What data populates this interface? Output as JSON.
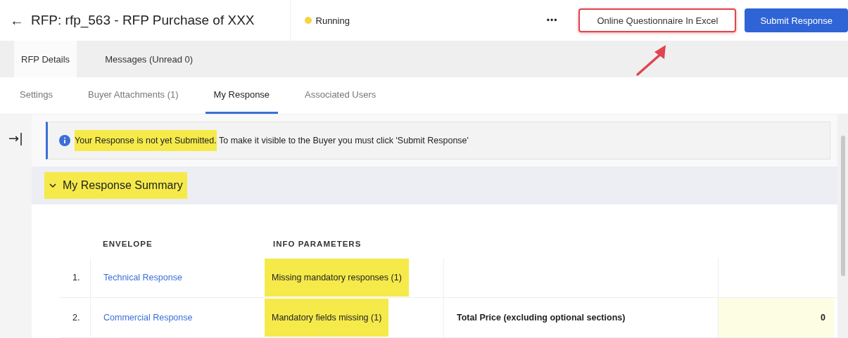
{
  "header": {
    "back": "←",
    "title": "RFP: rfp_563 - RFP Purchase of XXX",
    "status": {
      "label": "Running",
      "color": "#f5d442"
    },
    "more": "•••",
    "buttons": [
      {
        "label": "Online Questionnaire In Excel",
        "kind": "secondary",
        "annotated": true
      },
      {
        "label": "Submit Response",
        "kind": "primary",
        "annotated": false
      }
    ]
  },
  "tabs": [
    {
      "label": "RFP Details",
      "selected": true
    },
    {
      "label": "Messages (Unread 0)",
      "selected": false
    }
  ],
  "subtabs": [
    {
      "label": "Settings",
      "selected": false
    },
    {
      "label": "Buyer Attachments (1)",
      "selected": false
    },
    {
      "label": "My Response",
      "selected": true
    },
    {
      "label": "Associated Users",
      "selected": false
    }
  ],
  "rail_toggle": "→|",
  "notice": {
    "lead": "Your Response is not yet Submitted.",
    "lead_highlighted": true,
    "text": " To make it visible to the Buyer you must click 'Submit Response'"
  },
  "section": {
    "title": "My Response Summary",
    "expanded": true,
    "highlighted": true
  },
  "table": {
    "columns": [
      "ENVELOPE",
      "INFO PARAMETERS"
    ],
    "rows": [
      {
        "number": "1.",
        "envelope": "Technical Response",
        "info": "Missing mandatory responses (1)",
        "info_highlighted": true,
        "value_shaded": false
      },
      {
        "number": "2.",
        "envelope": "Commercial Response",
        "info": "Mandatory fields missing (1)",
        "info_highlighted": true,
        "label": "Total Price (excluding optional sections)",
        "value": "0",
        "value_shaded": true
      }
    ]
  }
}
